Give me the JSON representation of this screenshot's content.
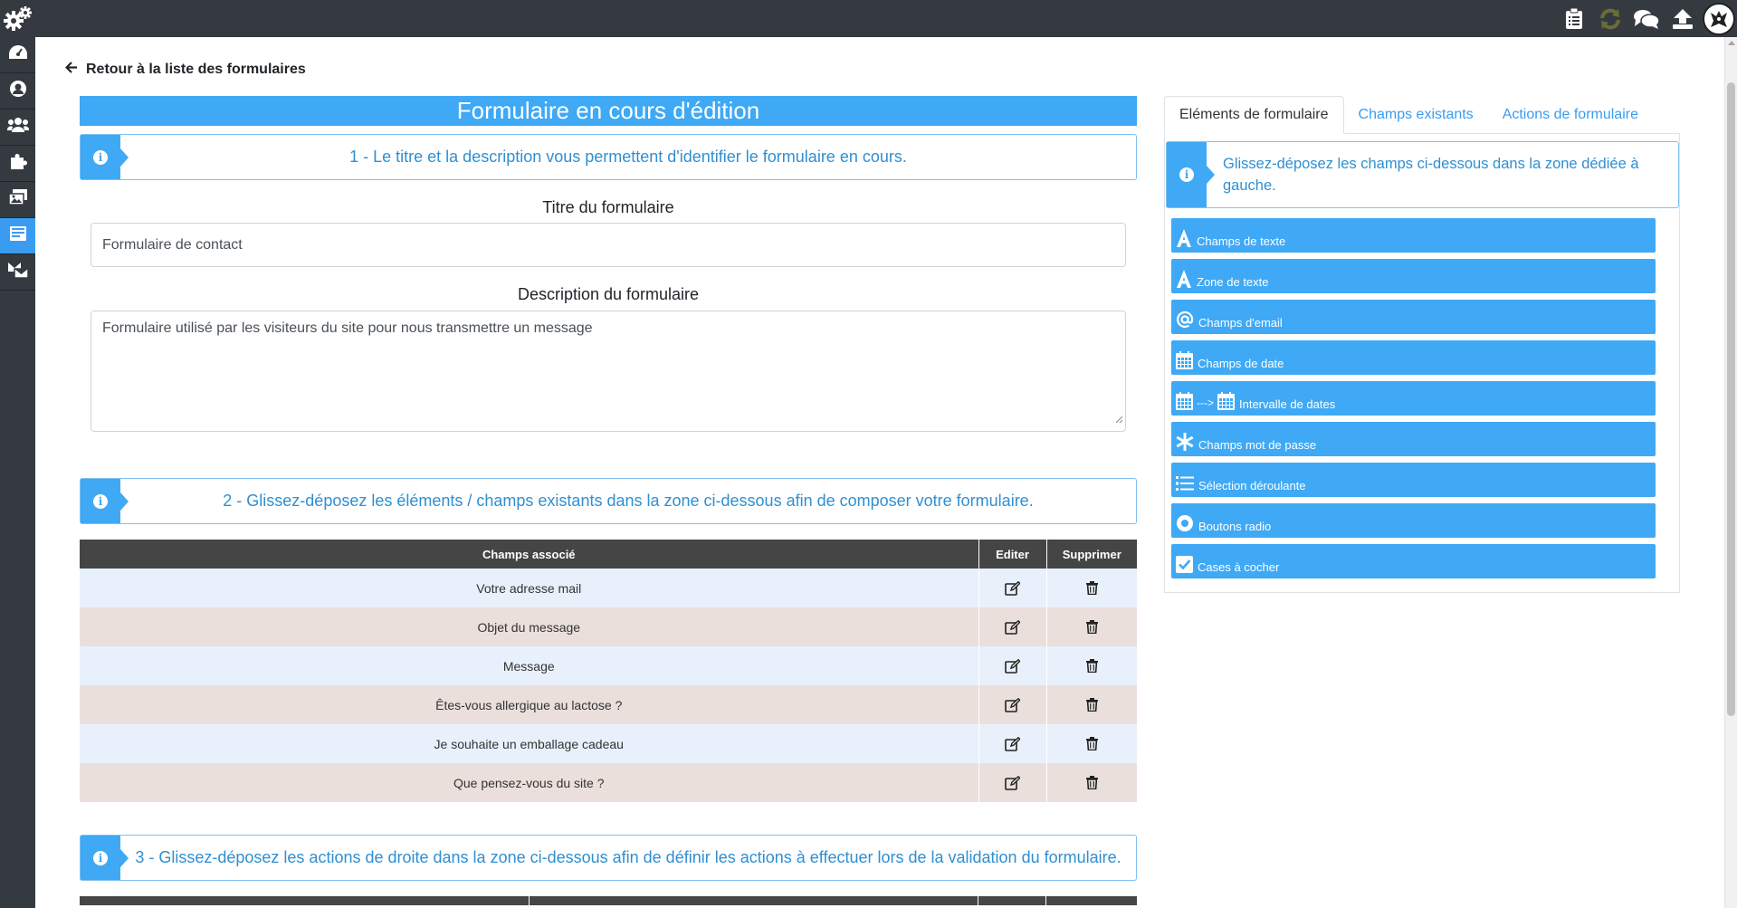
{
  "topbar": {
    "icons": [
      "settings-gears-icon",
      "clipboard-icon",
      "sync-icon",
      "chat-icon",
      "upload-icon",
      "user-avatar"
    ]
  },
  "sidebar": {
    "items": [
      "dashboard-icon",
      "user-icon",
      "users-icon",
      "puzzle-icon",
      "images-icon",
      "forms-icon",
      "messages-icon"
    ],
    "active_index": 5
  },
  "back_link": "Retour à la liste des formulaires",
  "main": {
    "title": "Formulaire en cours d'édition",
    "step1": "1 - Le titre et la description vous permettent d'identifier le formulaire en cours.",
    "title_label": "Titre du formulaire",
    "title_value": "Formulaire de contact",
    "description_label": "Description du formulaire",
    "description_value": "Formulaire utilisé par les visiteurs du site pour nous transmettre un message",
    "step2": "2 - Glissez-déposez les éléments / champs existants dans la zone ci-dessous afin de composer votre formulaire.",
    "table": {
      "headers": [
        "Champs associé",
        "Editer",
        "Supprimer"
      ],
      "rows": [
        "Votre adresse mail",
        "Objet du message",
        "Message",
        "Êtes-vous allergique au lactose ?",
        "Je souhaite un emballage cadeau",
        "Que pensez-vous du site ?"
      ]
    },
    "step3": "3 - Glissez-déposez les actions de droite dans la zone ci-dessous afin de définir les actions à effectuer lors de la validation du formulaire."
  },
  "right_panel": {
    "tabs": [
      "Eléments de formulaire",
      "Champs existants",
      "Actions de formulaire"
    ],
    "active_tab": 0,
    "info": "Glissez-déposez les champs ci-dessous dans la zone dédiée à gauche.",
    "elements": [
      {
        "label": "Champs de texte",
        "icon": "letter-a-icon"
      },
      {
        "label": "Zone de texte",
        "icon": "letter-a-icon"
      },
      {
        "label": "Champs d'email",
        "icon": "at-sign-icon"
      },
      {
        "label": "Champs de date",
        "icon": "calendar-icon"
      },
      {
        "label": "Intervalle de dates",
        "icon": "calendar-range-icon",
        "arrow": "--->"
      },
      {
        "label": "Champs mot de passe",
        "icon": "asterisk-icon"
      },
      {
        "label": "Sélection déroulante",
        "icon": "list-icon"
      },
      {
        "label": "Boutons radio",
        "icon": "radio-icon"
      },
      {
        "label": "Cases à cocher",
        "icon": "checkbox-icon"
      }
    ]
  },
  "colors": {
    "topbar": "#343a40",
    "accent": "#3fa9f5",
    "row_odd": "#e8f1fb",
    "row_even": "#ebdfdc",
    "table_header": "#454545"
  }
}
